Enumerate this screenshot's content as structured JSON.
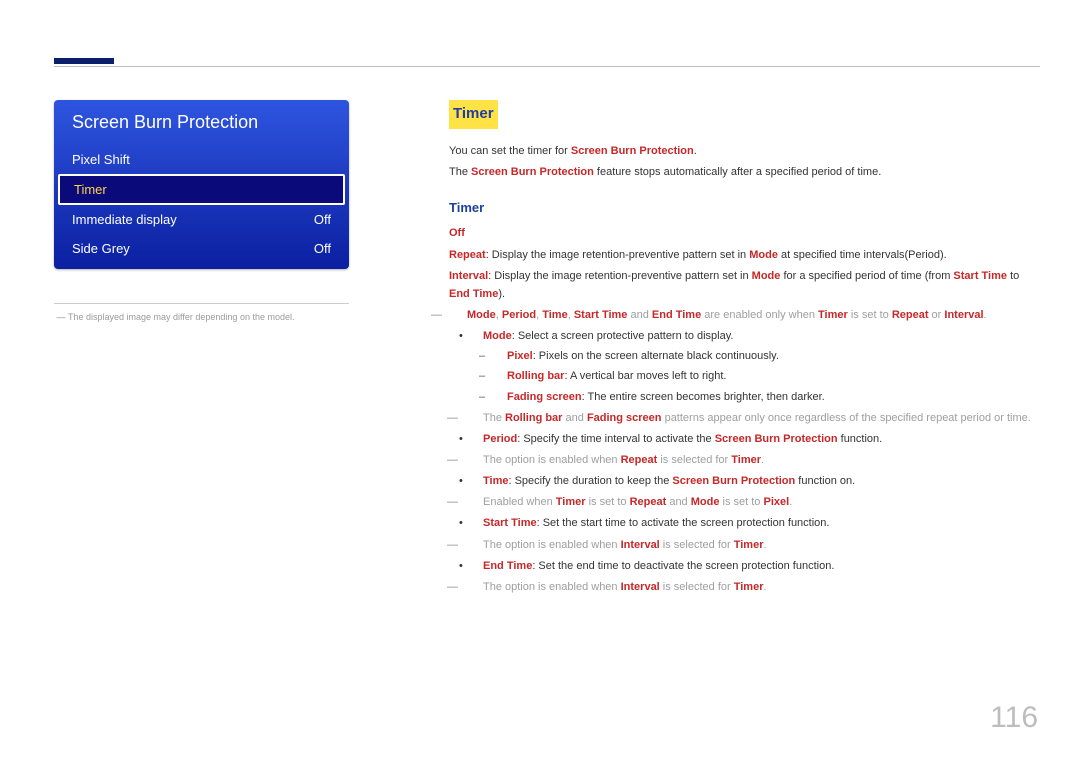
{
  "page_number": "116",
  "menu": {
    "title": "Screen Burn Protection",
    "items": [
      {
        "label": "Pixel Shift",
        "value": ""
      },
      {
        "label": "Timer",
        "value": ""
      },
      {
        "label": "Immediate display",
        "value": "Off"
      },
      {
        "label": "Side Grey",
        "value": "Off"
      }
    ]
  },
  "caption": "The displayed image may differ depending on the model.",
  "section": {
    "heading": "Timer",
    "intro_pre": "You can set the timer for ",
    "intro_kw": "Screen Burn Protection",
    "intro_post": ".",
    "intro2_pre": "The ",
    "intro2_kw": "Screen Burn Protection",
    "intro2_post": " feature stops automatically after a specified period of time.",
    "sub_heading": "Timer",
    "off_label": "Off",
    "repeat_kw": "Repeat",
    "repeat_text": ": Display the image retention-preventive pattern set in ",
    "mode_kw": "Mode",
    "repeat_tail": " at specified time intervals(Period).",
    "interval_kw": "Interval",
    "interval_text": ": Display the image retention-preventive pattern set in ",
    "interval_tail_pre": " for a specified period of time (from ",
    "start_time_kw": "Start Time",
    "interval_tail_mid": " to ",
    "end_time_kw": "End Time",
    "interval_tail_post": ").",
    "note1_kws": {
      "period": "Period",
      "time": "Time"
    },
    "note1_pre": ", ",
    "note1_mid": " and ",
    "note1_tail_pre": " are enabled only when ",
    "timer_kw": "Timer",
    "note1_tail_mid": " is set to ",
    "note1_or": " or ",
    "note1_tail_post": ".",
    "mode_text": ": Select a screen protective pattern to display.",
    "pixel_kw": "Pixel",
    "pixel_text": ": Pixels on the screen alternate black continuously.",
    "rolling_kw": "Rolling bar",
    "rolling_text": ": A vertical bar moves left to right.",
    "fading_kw": "Fading screen",
    "fading_text": ": The entire screen becomes brighter, then darker.",
    "pattern_note_pre": "The ",
    "pattern_note_mid": " and ",
    "pattern_note_post": " patterns appear only once regardless of the specified repeat period or time.",
    "period_text": ": Specify the time interval to activate the ",
    "function_post": " function.",
    "period_note_pre": "The option is enabled when ",
    "period_note_mid": " is selected for ",
    "period_note_post": ".",
    "time_text": ": Specify the duration to keep the ",
    "function_on_post": " function on.",
    "time_note_pre": "Enabled when ",
    "time_note_mid": " is set to ",
    "time_note_and": " and ",
    "time_note_mode_mid": " is set to ",
    "start_text": ": Set the start time to activate the screen protection function.",
    "start_note_pre": "The option is enabled when ",
    "start_note_mid": " is selected for ",
    "end_text": ": Set the end time to deactivate the screen protection function.",
    "end_note_pre": "The option is enabled when ",
    "end_note_mid": " is selected for "
  }
}
